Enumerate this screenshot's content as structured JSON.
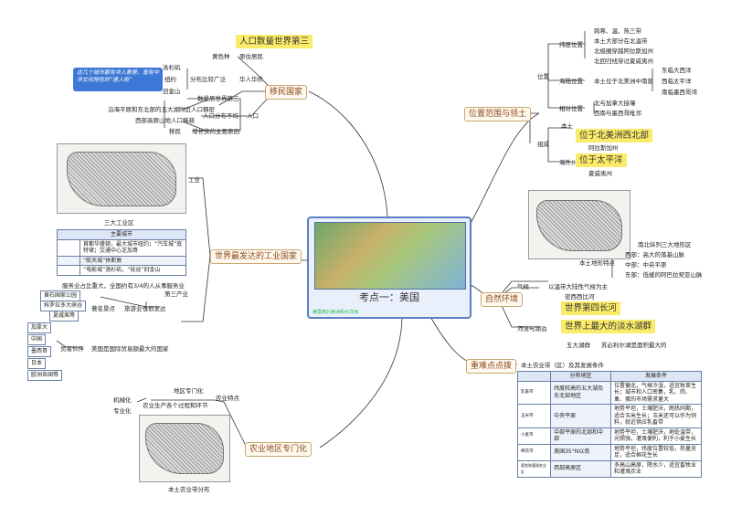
{
  "center": {
    "title": "考点一：美国",
    "note": "美国南北美洲和大洋洲"
  },
  "branches": {
    "migrant": "移民国家",
    "location": "位置范围与领土",
    "industry": "世界最发达的工业国家",
    "nature": "自然环境",
    "agri": "农业地区专门化",
    "key": "重难点点拨"
  },
  "migrant": {
    "pop_highlight": "人口数量世界第三",
    "color": "黄色种",
    "orig": "原住居民",
    "la": "洛杉矶",
    "ny": "纽约",
    "sf": "旧金山",
    "dist": "分布比较广泛",
    "chinese": "华人华侨",
    "callout": "这几个城市都有华人聚居，富有中华文化特色的“唐人街”",
    "pop3": "数量居世界第三",
    "east": "沿海平原和东北部的五大湖附近人口稠密",
    "popdist": "人口分布不均",
    "west": "西部高原山地人口稀疏",
    "pop": "人口",
    "migrate": "移民",
    "growth": "增长快的主要原因"
  },
  "location": {
    "pos": "位置",
    "lat": "纬度位置",
    "lat1": "跨寒、温、热三带",
    "lat2": "本土大部分在北温带",
    "lat3": "北极圈穿越阿拉斯加州",
    "lat4": "北回归线穿过夏威夷州",
    "sea": "海陆位置",
    "sea1": "本土位于北美洲中南部",
    "sea_e": "东临大西洋",
    "sea_w": "西临太平洋",
    "sea_s": "南临墨西哥湾",
    "rel": "相对位置",
    "rel1": "北与加拿大接壤",
    "rel2": "西南与墨西哥毗邻",
    "comp": "组成",
    "main": "本土",
    "main_hl": "位于北美洲西北部",
    "alaska": "阿拉斯加州",
    "overseas": "海外州",
    "pac_hl": "位于太平洋",
    "hawaii": "夏威夷州"
  },
  "nature": {
    "terrain": "本土地形特点",
    "t1": "南北纵列三大地形区",
    "t2": "西部：高大的落基山脉",
    "t3": "中部：中央平原",
    "t4": "东部：低缓的阿巴拉契亚山脉",
    "climate": "气候",
    "climate1": "以温带大陆性气候为主",
    "river": "河流与湖泊",
    "miss": "密西西比河",
    "miss_hl": "世界第四长河",
    "lakes_hl": "世界上最大的淡水湖群",
    "lakes": "五大湖群",
    "superior": "苏必利尔湖是面积最大的"
  },
  "industry": {
    "ind": "工业",
    "cap": "三大工业区",
    "cities_head": "主要城市",
    "r1": "首都华盛顿，最大城市纽约；“汽车城”底特律；交通中心芝加哥",
    "r2": "“航天城”休斯敦",
    "r3": "“电影城”洛杉矶，“硅谷”旧金山",
    "tertiary": "第三产业",
    "svc": "服务业占比重大，全国约有3/4的人从事服务业",
    "yellowstone": "黄石国家公园",
    "colorado": "科罗拉多大峡谷",
    "hawaii": "夏威夷等",
    "spots": "著名景点",
    "tour": "旅游业也很发达",
    "partners": "贸易伙伴",
    "p1": "加拿大",
    "p2": "中国",
    "p3": "墨西哥",
    "p4": "日本",
    "p5": "欧洲各国等",
    "trade": "美国是国际贸易额最大的国家"
  },
  "agri": {
    "mech": "机械化",
    "spec": "专业化",
    "region": "地区专门化",
    "process": "农业生产各个过程和环节",
    "feature": "农业特点",
    "mapcap": "本土农业带分布"
  },
  "key": {
    "head": "本土农业带（区）及其发展条件",
    "cols": [
      "分布地区",
      "发展条件"
    ],
    "rows": [
      {
        "belt": "乳畜带",
        "area": "纬度较高的五大湖及东北部地区",
        "cond": "位置偏北，气候冷湿，适宜牧草生长；城市和人口密集，乳、肉、禽、蛋的市场需求量大"
      },
      {
        "belt": "玉米带",
        "area": "中央平原",
        "cond": "地势平坦，土壤肥沃，雨热同期，适合玉米生长；玉米还可以作为饲料，就近供应乳畜带"
      },
      {
        "belt": "小麦带",
        "area": "中部平原的北部和中部",
        "cond": "地势平坦，土壤肥沃，地处温带，光照强，灌溉便利，利于小麦生长"
      },
      {
        "belt": "棉花带",
        "area": "美国35°N以南",
        "cond": "地势平坦，纬度位置较低，热量充足，适合棉花生长"
      },
      {
        "belt": "畜牧和灌溉农业区",
        "area": "西部高原区",
        "cond": "多高山高原，降水少，适宜畜牧业和灌溉农业"
      }
    ]
  }
}
